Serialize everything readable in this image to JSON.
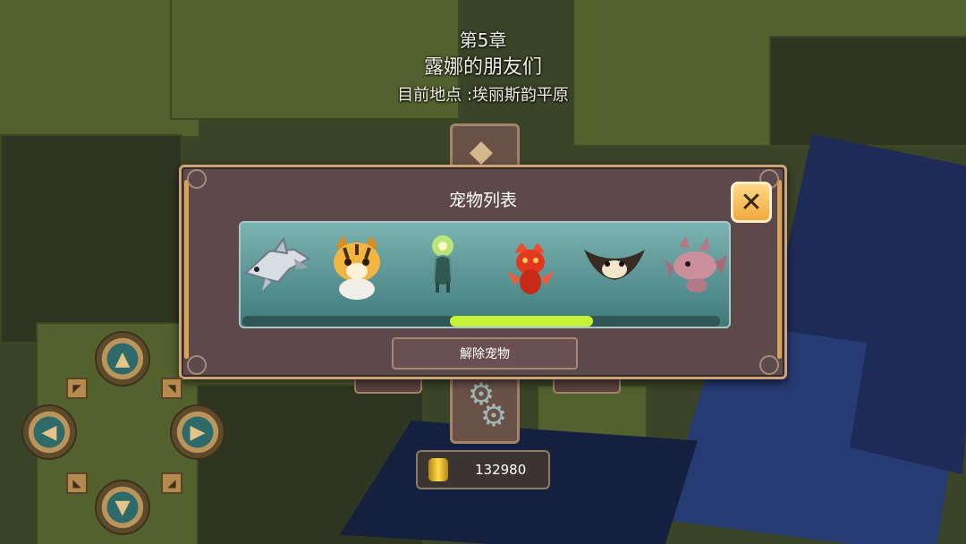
{
  "header": {
    "chapter": "第5章",
    "title": "露娜的朋友们",
    "location": "目前地点 :埃丽斯韵平原"
  },
  "pet_panel": {
    "title": "宠物列表",
    "close_label": "✕",
    "release_button": "解除宠物",
    "scroll_position": 0.62,
    "pets": [
      {
        "icon": "shark-pet-icon"
      },
      {
        "icon": "tiger-cub-pet-icon"
      },
      {
        "icon": "green-spirit-pet-icon"
      },
      {
        "icon": "red-dragon-pet-icon"
      },
      {
        "icon": "manta-ray-pet-icon"
      },
      {
        "icon": "pink-dragon-pet-icon"
      }
    ]
  },
  "currency": {
    "icon": "gold-coin-stack-icon",
    "amount": "132980"
  },
  "controls": {
    "up": "up-arrow-icon",
    "down": "down-arrow-icon",
    "left": "left-arrow-icon",
    "right": "right-arrow-icon"
  },
  "colors": {
    "accent": "#c6f238",
    "close_button": "#f0a93c",
    "panel": "#5d484c",
    "strip": "#5f9899"
  }
}
